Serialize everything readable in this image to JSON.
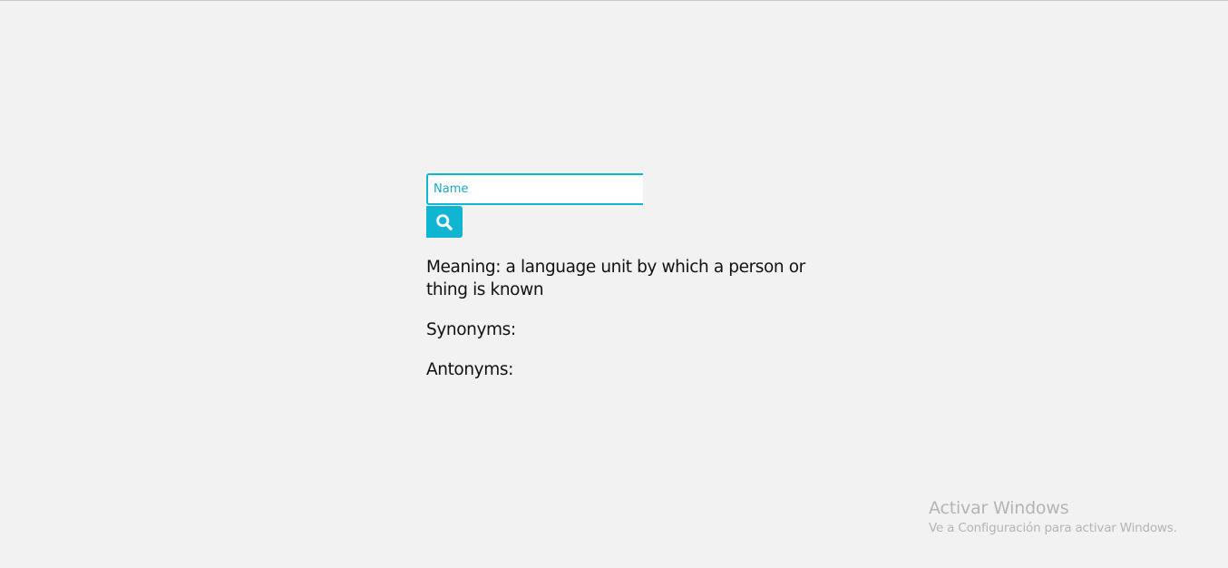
{
  "search": {
    "value": "Name",
    "button_icon": "search-icon"
  },
  "result": {
    "meaning": "Meaning: a language unit by which a person or thing is known",
    "synonyms": "Synonyms:",
    "antonyms": "Antonyms:"
  },
  "os_watermark": {
    "title": "Activar Windows",
    "subtitle": "Ve a Configuración para activar Windows."
  },
  "colors": {
    "accent": "#10b6d1",
    "background": "#f2f2f2",
    "text": "#111111",
    "watermark": "#b4b4b4"
  }
}
